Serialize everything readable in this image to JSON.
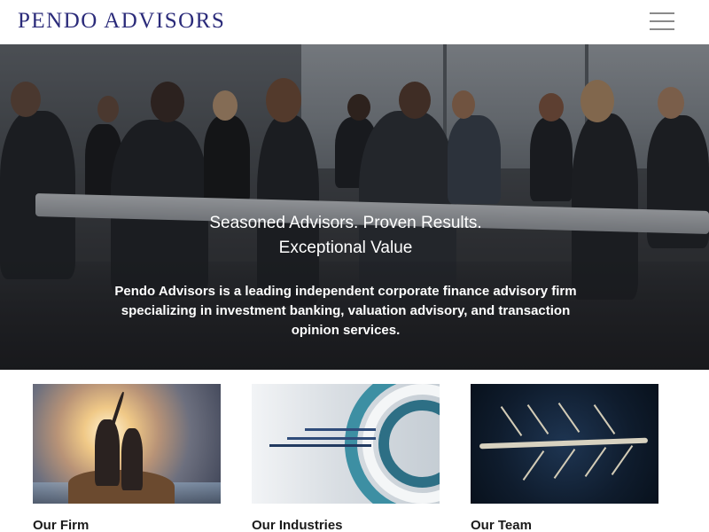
{
  "header": {
    "logo_text": "PENDO ADVISORS",
    "menu_icon": "hamburger-menu-icon"
  },
  "hero": {
    "title": "Seasoned Advisors. Proven Results. Exceptional Value",
    "description": "Pendo Advisors is a leading independent corporate finance advisory firm specializing in investment banking, valuation advisory, and transaction opinion services."
  },
  "cards": [
    {
      "label": "Our Firm"
    },
    {
      "label": "Our Industries"
    },
    {
      "label": "Our Team"
    }
  ],
  "colors": {
    "brand": "#2b2b7a",
    "menu_icon": "#8a8a8a"
  }
}
